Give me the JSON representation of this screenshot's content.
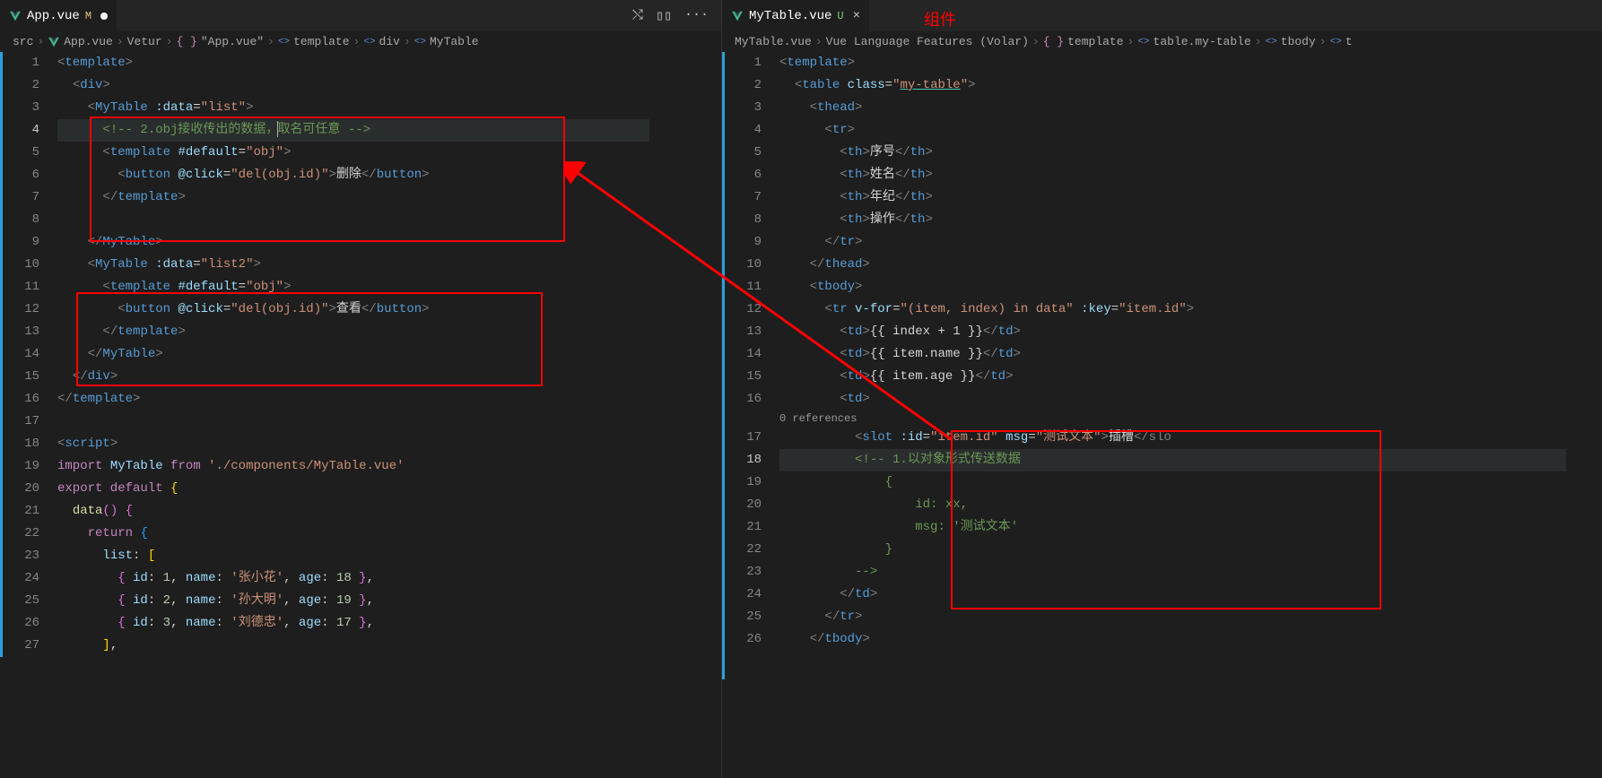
{
  "annotations": {
    "component_label": "组件"
  },
  "leftPane": {
    "tab": {
      "name": "App.vue",
      "status": "M"
    },
    "tabActions": {
      "compare": "⤭",
      "split": "▯▯",
      "more": "···"
    },
    "breadcrumb": {
      "p0": "src",
      "p1": "App.vue",
      "p2": "Vetur",
      "p3": "\"App.vue\"",
      "p4": "template",
      "p5": "div",
      "p6": "MyTable"
    },
    "lines": [
      "1",
      "2",
      "3",
      "4",
      "5",
      "6",
      "7",
      "8",
      "9",
      "10",
      "11",
      "12",
      "13",
      "14",
      "15",
      "16",
      "17",
      "18",
      "19",
      "20",
      "21",
      "22",
      "23",
      "24",
      "25",
      "26",
      "27"
    ],
    "code": {
      "l1": {
        "tag": "template"
      },
      "l2": {
        "tag": "div"
      },
      "l3": {
        "tag": "MyTable",
        "attr": ":data",
        "val": "\"list\""
      },
      "l4": {
        "comment": "<!-- 2.obj接收传出的数据，取名可任意 -->",
        "c_part1": "<!-- 2.obj接收传出的数据，",
        "c_part2": "取名可任意 -->"
      },
      "l5": {
        "tag": "template",
        "attr": "#default",
        "val": "\"obj\""
      },
      "l6": {
        "tag": "button",
        "attr": "@click",
        "val": "\"del(obj.id)\"",
        "text": "删除"
      },
      "l7": {
        "close": "template"
      },
      "l8": "",
      "l9": {
        "close": "MyTable"
      },
      "l10": {
        "tag": "MyTable",
        "attr": ":data",
        "val": "\"list2\""
      },
      "l11": {
        "tag": "template",
        "attr": "#default",
        "val": "\"obj\""
      },
      "l12": {
        "tag": "button",
        "attr": "@click",
        "val": "\"del(obj.id)\"",
        "text": "查看"
      },
      "l13": {
        "close": "template"
      },
      "l14": {
        "close": "MyTable"
      },
      "l15": {
        "close": "div"
      },
      "l16": {
        "close": "template"
      },
      "l18": {
        "tag": "script"
      },
      "l19": {
        "import": "import",
        "name": "MyTable",
        "from": "from",
        "path": "'./components/MyTable.vue'"
      },
      "l20": {
        "export": "export default",
        "brace": "{"
      },
      "l21": {
        "fn": "data",
        "paren": "()",
        "brace": "{"
      },
      "l22": {
        "ret": "return",
        "brace": "{"
      },
      "l23": {
        "prop": "list",
        "val": "["
      },
      "l24_raw": "        { id: 1, name: '张小花', age: 18 },",
      "l24": {
        "id": "1",
        "name": "'张小花'",
        "age": "18"
      },
      "l25": {
        "id": "2",
        "name": "'孙大明'",
        "age": "19"
      },
      "l26": {
        "id": "3",
        "name": "'刘德忠'",
        "age": "17"
      },
      "l27": "],"
    }
  },
  "rightPane": {
    "tab": {
      "name": "MyTable.vue",
      "status": "U"
    },
    "breadcrumb": {
      "p0": "MyTable.vue",
      "p1": "Vue Language Features (Volar)",
      "p2": "template",
      "p3": "table.my-table",
      "p4": "tbody",
      "p5": "t"
    },
    "lines": [
      "1",
      "2",
      "3",
      "4",
      "5",
      "6",
      "7",
      "8",
      "9",
      "10",
      "11",
      "12",
      "13",
      "14",
      "15",
      "16",
      "",
      "17",
      "18",
      "19",
      "20",
      "21",
      "22",
      "23",
      "24",
      "25",
      "26"
    ],
    "codelens": "0 references",
    "code": {
      "l1": {
        "tag": "template"
      },
      "l2": {
        "tag": "table",
        "attr": "class",
        "val": "\"my-table\"",
        "cls": "my-table"
      },
      "l3": {
        "tag": "thead"
      },
      "l4": {
        "tag": "tr"
      },
      "l5": {
        "tag": "th",
        "text": "序号"
      },
      "l6": {
        "tag": "th",
        "text": "姓名"
      },
      "l7": {
        "tag": "th",
        "text": "年纪"
      },
      "l8": {
        "tag": "th",
        "text": "操作"
      },
      "l9": {
        "close": "tr"
      },
      "l10": {
        "close": "thead"
      },
      "l11": {
        "tag": "tbody"
      },
      "l12": {
        "tag": "tr",
        "a1": "v-for",
        "v1": "\"(item, index) in data\"",
        "a2": ":key",
        "v2": "\"item.id\""
      },
      "l13": {
        "tag": "td",
        "expr": "{{ index + 1 }}"
      },
      "l14": {
        "tag": "td",
        "expr": "{{ item.name }}"
      },
      "l15": {
        "tag": "td",
        "expr": "{{ item.age }}"
      },
      "l16": {
        "tag": "td"
      },
      "l17": {
        "tag": "slot",
        "a1": ":id",
        "v1": "\"item.id\"",
        "a2": "msg",
        "v2": "\"测试文本\"",
        "text": "插槽",
        "tail": "</slo"
      },
      "l18": {
        "c": "<!-- 1.以对象形式传送数据"
      },
      "l19": {
        "c": "{"
      },
      "l20": {
        "c": "id: xx,"
      },
      "l21": {
        "c": "msg: '测试文本'"
      },
      "l22": {
        "c": "}"
      },
      "l23": {
        "c": "-->"
      },
      "l24": {
        "close": "td"
      },
      "l25": {
        "close": "tr"
      },
      "l26": {
        "close": "tbody"
      }
    }
  }
}
